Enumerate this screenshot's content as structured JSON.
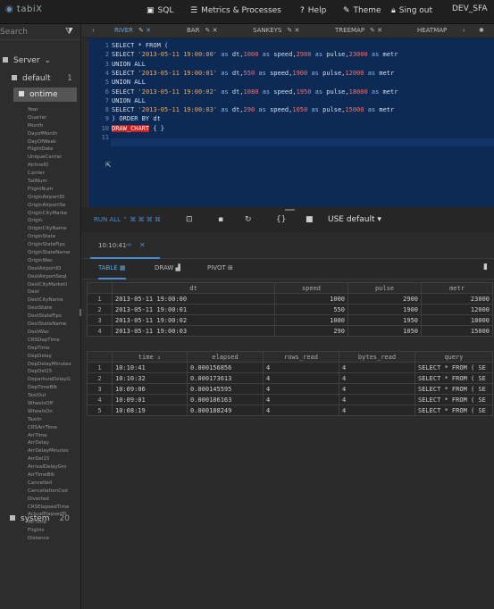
{
  "app": {
    "logo": "tabiX"
  },
  "topbar": {
    "sql": "SQL",
    "metrics": "Metrics & Processes",
    "help": "Help",
    "theme": "Theme",
    "signout": "Sing out",
    "user": "DEV_SFA"
  },
  "sidebar": {
    "search_placeholder": "Search",
    "server_label": "Server",
    "database": {
      "name": "default",
      "count": "1"
    },
    "table": {
      "name": "ontime"
    },
    "columns": [
      "Year",
      "Quarter",
      "Month",
      "DayofMonth",
      "DayOfWeek",
      "FlightDate",
      "UniqueCarrier",
      "AirlineID",
      "Carrier",
      "TailNum",
      "FlightNum",
      "OriginAirportID",
      "OriginAirportSe",
      "OriginCityMarke",
      "Origin",
      "OriginCityName",
      "OriginState",
      "OriginStateFips",
      "OriginStateName",
      "OriginWac",
      "DestAirportID",
      "DestAirportSeqI",
      "DestCityMarketI",
      "Dest",
      "DestCityName",
      "DestState",
      "DestStateFips",
      "DestStateName",
      "DestWac",
      "CRSDepTime",
      "DepTime",
      "DepDelay",
      "DepDelayMinutes",
      "DepDel15",
      "DepartureDelayG",
      "DepTimeBlk",
      "TaxiOut",
      "WheelsOff",
      "WheelsOn",
      "TaxiIn",
      "CRSArrTime",
      "ArrTime",
      "ArrDelay",
      "ArrDelayMinutes",
      "ArrDel15",
      "ArrivalDelayGro",
      "ArrTimeBlk",
      "Cancelled",
      "CancellationCod",
      "Diverted",
      "CRSElapsedTime",
      "ActualElapsedTi",
      "AirTime",
      "Flights",
      "Distance"
    ],
    "system": {
      "name": "system",
      "count": "20"
    }
  },
  "tabs": [
    {
      "label": "RIVER",
      "active": true
    },
    {
      "label": "BAR",
      "active": false
    },
    {
      "label": "SANKEYS",
      "active": false
    },
    {
      "label": "TREEMAP",
      "active": false
    },
    {
      "label": "HEATMAP",
      "active": false
    }
  ],
  "editor": {
    "line_numbers": [
      "1",
      "2",
      "3",
      "4",
      "5",
      "6",
      "7",
      "8",
      "9",
      "10",
      "11"
    ],
    "lines": [
      "SELECT * FROM (",
      "SELECT '2013-05-11 19:00:00' as dt,1000 as speed,2900 as pulse,23000 as metr",
      "UNION ALL",
      "SELECT '2013-05-11 19:00:01' as dt,550 as speed,1900 as pulse,12000 as metr",
      "UNION ALL",
      "SELECT '2013-05-11 19:00:02' as dt,1080 as speed,1950 as pulse,18000 as metr",
      "UNION ALL",
      "SELECT '2013-05-11 19:00:03' as dt,290 as speed,1050 as pulse,15000 as metr",
      ") ORDER BY dt",
      "DRAW_CHART { }",
      ""
    ]
  },
  "toolbar": {
    "run_all": "RUN ALL ⌃ ⌘ ⌘ ⌘ ⌘",
    "use_default": "USE default"
  },
  "result": {
    "tab_time": "10:10:41"
  },
  "views": {
    "table": "TABLE",
    "draw": "DRAW",
    "pivot": "PIVOT"
  },
  "data_table": {
    "headers": [
      "",
      "dt",
      "speed",
      "pulse",
      "metr"
    ],
    "rows": [
      [
        "1",
        "2013-05-11 19:00:00",
        "1000",
        "2900",
        "23000"
      ],
      [
        "2",
        "2013-05-11 19:00:01",
        "550",
        "1900",
        "12000"
      ],
      [
        "3",
        "2013-05-11 19:00:02",
        "1080",
        "1950",
        "18000"
      ],
      [
        "4",
        "2013-05-11 19:00:03",
        "290",
        "1050",
        "15000"
      ]
    ]
  },
  "history_table": {
    "headers": [
      "",
      "time ↓",
      "elapsed",
      "rows_read",
      "bytes_read",
      "query"
    ],
    "rows": [
      [
        "1",
        "10:10:41",
        "0.000156856",
        "4",
        "4",
        "SELECT * FROM ( SE"
      ],
      [
        "2",
        "10:10:32",
        "0.000173613",
        "4",
        "4",
        "SELECT * FROM ( SE"
      ],
      [
        "3",
        "10:09:06",
        "0.000145595",
        "4",
        "4",
        "SELECT * FROM ( SE"
      ],
      [
        "4",
        "10:09:01",
        "0.000186163",
        "4",
        "4",
        "SELECT * FROM ( SE"
      ],
      [
        "5",
        "10:08:19",
        "0.000188249",
        "4",
        "4",
        "SELECT * FROM ( SE"
      ]
    ]
  }
}
